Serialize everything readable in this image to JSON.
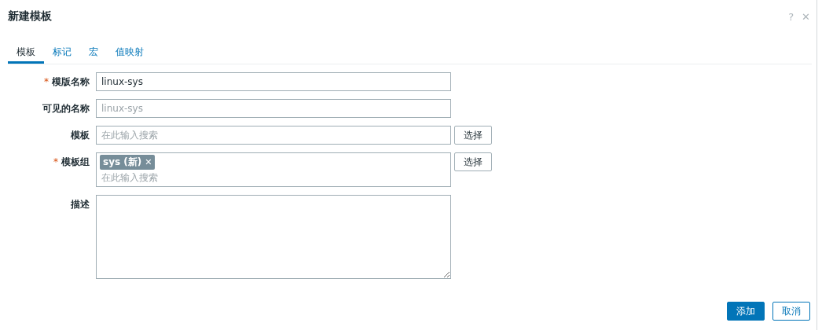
{
  "dialog": {
    "title": "新建模板",
    "help": "?",
    "close": "✕"
  },
  "tabs": [
    {
      "label": "模板",
      "selected": true
    },
    {
      "label": "标记",
      "selected": false
    },
    {
      "label": "宏",
      "selected": false
    },
    {
      "label": "值映射",
      "selected": false
    }
  ],
  "required_mark": "*",
  "fields": [
    {
      "kind": "text",
      "label": "模版名称",
      "required": true,
      "value": "linux-sys"
    },
    {
      "kind": "text",
      "label": "可见的名称",
      "required": false,
      "placeholder": "linux-sys"
    },
    {
      "kind": "multiselect",
      "label": "模板",
      "required": false,
      "placeholder": "在此输入搜索",
      "button": "选择"
    },
    {
      "kind": "multiselect",
      "label": "模板组",
      "required": true,
      "tags": [
        {
          "label": "sys (新)",
          "remove": "✕"
        }
      ],
      "placeholder": "在此输入搜索",
      "button": "选择"
    },
    {
      "kind": "textarea",
      "label": "描述",
      "required": false
    }
  ],
  "buttons": [
    {
      "label": "添加",
      "kind": "primary"
    },
    {
      "label": "取消",
      "kind": "secondary"
    }
  ]
}
